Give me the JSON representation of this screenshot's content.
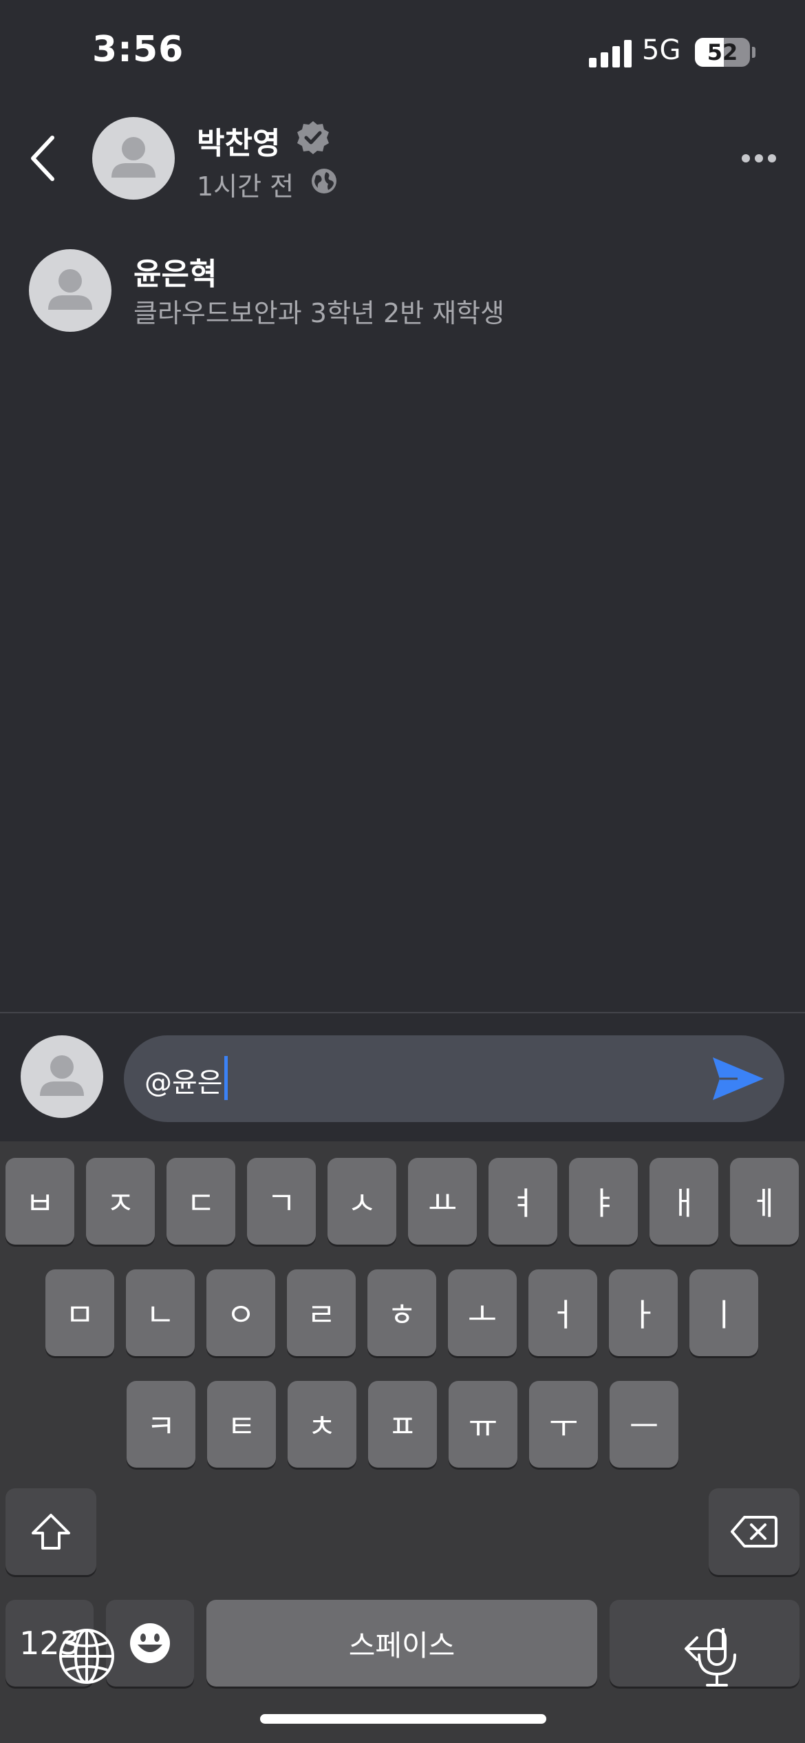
{
  "status_bar": {
    "time": "3:56",
    "network": "5G",
    "battery_percent": "52",
    "battery_level": 0.52,
    "signal_bars": 4
  },
  "header": {
    "author_name": "박찬영",
    "post_time": "1시간 전",
    "verified": true,
    "icons": [
      "back-chevron-icon",
      "verified-badge-icon",
      "globe-icon",
      "more-options-icon"
    ]
  },
  "mention_suggestion": {
    "name": "윤은혁",
    "description": "클라우드보안과 3학년 2반 재학생"
  },
  "composer": {
    "input_value": "@윤은",
    "send_icon": "send-icon"
  },
  "keyboard": {
    "row1": [
      "ㅂ",
      "ㅈ",
      "ㄷ",
      "ㄱ",
      "ㅅ",
      "ㅛ",
      "ㅕ",
      "ㅑ",
      "ㅐ",
      "ㅔ"
    ],
    "row2": [
      "ㅁ",
      "ㄴ",
      "ㅇ",
      "ㄹ",
      "ㅎ",
      "ㅗ",
      "ㅓ",
      "ㅏ",
      "ㅣ"
    ],
    "row3": [
      "ㅋ",
      "ㅌ",
      "ㅊ",
      "ㅍ",
      "ㅠ",
      "ㅜ",
      "ㅡ"
    ],
    "numbers_label": "123",
    "space_label": "스페이스",
    "icons": [
      "shift-icon",
      "backspace-icon",
      "emoji-icon",
      "return-icon",
      "globe-icon",
      "microphone-icon"
    ]
  },
  "colors": {
    "background": "#2b2c31",
    "accent": "#3b82f6",
    "secondary_text": "#a8a9ae",
    "keyboard_bg": "#3a3a3c",
    "key_bg": "#6d6d70"
  }
}
